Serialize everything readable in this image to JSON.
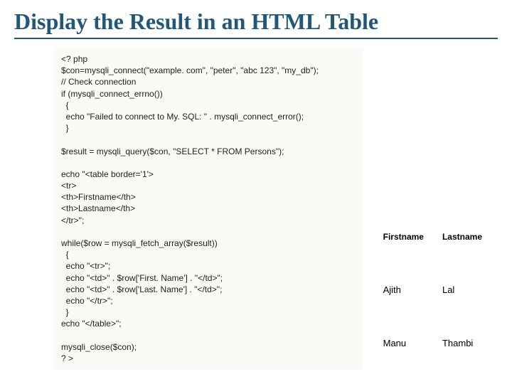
{
  "header": {
    "title": "Display the Result in an HTML Table"
  },
  "code": {
    "text": "<? php\n$con=mysqli_connect(\"example. com\", \"peter\", \"abc 123\", \"my_db\");\n// Check connection\nif (mysqli_connect_errno())\n  {\n  echo \"Failed to connect to My. SQL: \" . mysqli_connect_error();\n  }\n\n$result = mysqli_query($con, \"SELECT * FROM Persons\");\n\necho \"<table border='1'>\n<tr>\n<th>Firstname</th>\n<th>Lastname</th>\n</tr>\";\n\nwhile($row = mysqli_fetch_array($result))\n  {\n  echo \"<tr>\";\n  echo \"<td>\" . $row['First. Name'] . \"</td>\";\n  echo \"<td>\" . $row['Last. Name'] . \"</td>\";\n  echo \"</tr>\";\n  }\necho \"</table>\";\n\nmysqli_close($con);\n? >"
  },
  "table": {
    "headers": {
      "col1": "Firstname",
      "col2": "Lastname"
    },
    "rows": [
      {
        "first": "Ajith",
        "last": "Lal"
      },
      {
        "first": "Manu",
        "last": "Thambi"
      }
    ]
  }
}
